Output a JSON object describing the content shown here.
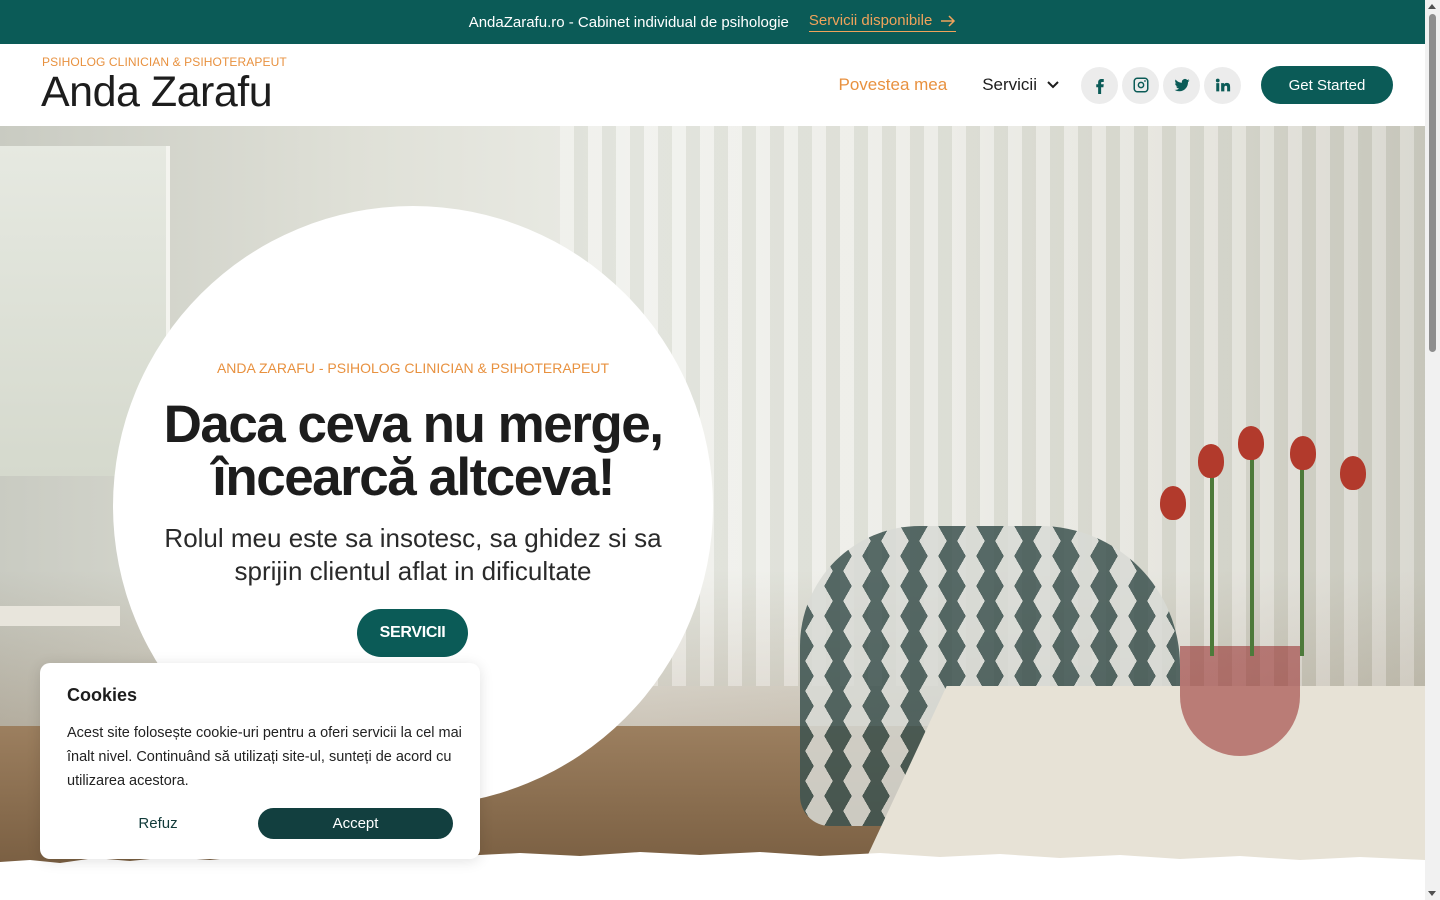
{
  "topbar": {
    "text": "AndaZarafu.ro - Cabinet individual de psihologie",
    "link_label": "Servicii disponibile",
    "link_icon": "arrow-right-icon"
  },
  "header": {
    "brand_subtitle": "PSIHOLOG CLINICIAN & PSIHOTERAPEUT",
    "brand_title": "Anda Zarafu",
    "nav": {
      "story_label": "Povestea mea",
      "services_label": "Servicii"
    },
    "social_icons": [
      "facebook-icon",
      "instagram-icon",
      "twitter-icon",
      "linkedin-icon"
    ],
    "cta_label": "Get Started"
  },
  "hero": {
    "kicker": "ANDA ZARAFU - PSIHOLOG CLINICIAN & PSIHOTERAPEUT",
    "title": "Daca ceva nu merge, încearcă altceva!",
    "subtitle": "Rolul meu este sa insotesc, sa ghidez si sa sprijin clientul aflat in dificultate",
    "button_label": "SERVICII"
  },
  "cookie": {
    "title": "Cookies",
    "text": "Acest site folosește cookie-uri pentru a oferi servicii la cel mai înalt nivel. Continuând să utilizați site-ul, sunteți de acord cu utilizarea acestora.",
    "refuse_label": "Refuz",
    "accept_label": "Accept"
  },
  "colors": {
    "brand_green": "#0b5b57",
    "accent_orange": "#e8913f",
    "cookie_button": "#123f3f"
  }
}
